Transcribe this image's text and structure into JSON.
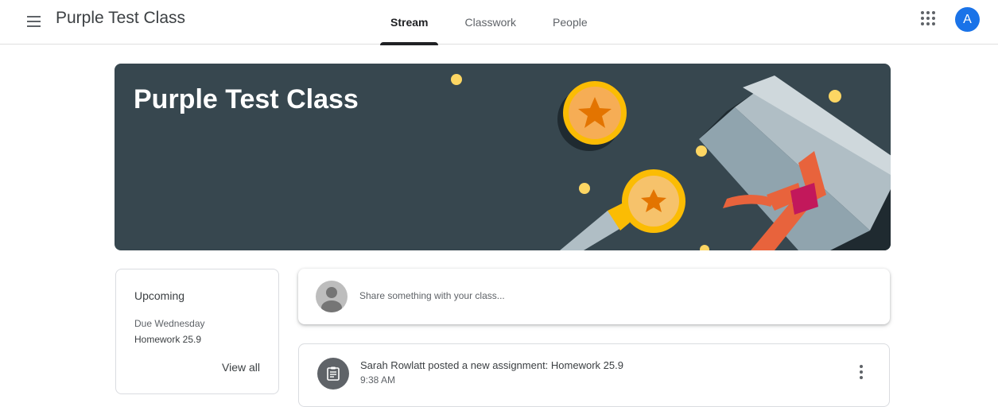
{
  "header": {
    "title": "Purple Test Class",
    "tabs": [
      {
        "label": "Stream",
        "active": true
      },
      {
        "label": "Classwork",
        "active": false
      },
      {
        "label": "People",
        "active": false
      }
    ],
    "avatar_letter": "A",
    "avatar_color": "#1a73e8"
  },
  "banner": {
    "title": "Purple Test Class",
    "background_color": "#37474f"
  },
  "upcoming": {
    "title": "Upcoming",
    "due": "Due Wednesday",
    "item": "Homework 25.9",
    "view_all": "View all"
  },
  "share": {
    "placeholder": "Share something with your class..."
  },
  "post": {
    "title": "Sarah Rowlatt posted a new assignment: Homework 25.9",
    "time": "9:38 AM",
    "icon": "assignment-icon"
  }
}
